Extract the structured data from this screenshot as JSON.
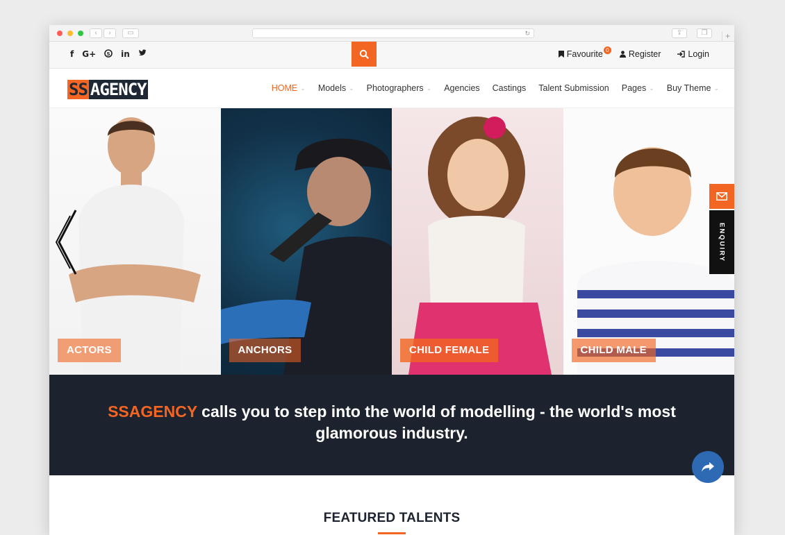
{
  "social": {
    "facebook": "f",
    "googleplus": "G+",
    "skype": "S",
    "linkedin": "in",
    "twitter": "t"
  },
  "topbar": {
    "favourite": "Favourite",
    "favourite_count": "0",
    "register": "Register",
    "login": "Login"
  },
  "logo": {
    "part1": "SS",
    "part2": "AGENCY"
  },
  "menu": [
    {
      "label": "HOME"
    },
    {
      "label": "Models"
    },
    {
      "label": "Photographers"
    },
    {
      "label": "Agencies"
    },
    {
      "label": "Castings"
    },
    {
      "label": "Talent Submission"
    },
    {
      "label": "Pages"
    },
    {
      "label": "Buy Theme"
    }
  ],
  "hero": {
    "panels": [
      {
        "label": "ACTORS"
      },
      {
        "label": "ANCHORS"
      },
      {
        "label": "CHILD FEMALE"
      },
      {
        "label": "CHILD MALE"
      }
    ]
  },
  "enquiry": {
    "label": "ENQUIRY"
  },
  "band": {
    "brand": "SSAGENCY",
    "tagline": " calls you to step into the world of modelling - the world's most glamorous industry."
  },
  "featured": {
    "title": "FEATURED TALENTS"
  },
  "colors": {
    "accent": "#f26522",
    "dark": "#1c232e",
    "share": "#2d6ab3"
  }
}
